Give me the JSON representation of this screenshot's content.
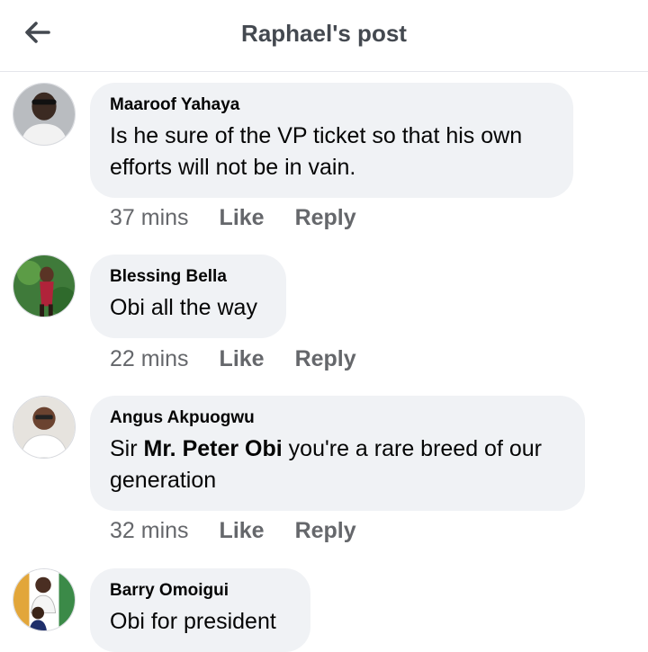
{
  "header": {
    "title": "Raphael's post"
  },
  "comments": [
    {
      "author": "Maaroof Yahaya",
      "text": "Is he sure of the VP ticket so that his own efforts will not be in vain.",
      "time": "37 mins",
      "like": "Like",
      "reply": "Reply"
    },
    {
      "author": "Blessing Bella",
      "text": "Obi all the way",
      "time": "22 mins",
      "like": "Like",
      "reply": "Reply"
    },
    {
      "author": "Angus Akpuogwu",
      "text_pre": "Sir ",
      "text_bold": "Mr. Peter Obi",
      "text_post": " you're a rare breed of our generation",
      "time": "32 mins",
      "like": "Like",
      "reply": "Reply"
    },
    {
      "author": "Barry Omoigui",
      "text": "Obi for president"
    }
  ],
  "colors": {
    "bubble": "#f0f2f5",
    "meta_text": "#65676b",
    "title_text": "#444950"
  },
  "icons": {
    "back": "arrow-left-icon"
  }
}
